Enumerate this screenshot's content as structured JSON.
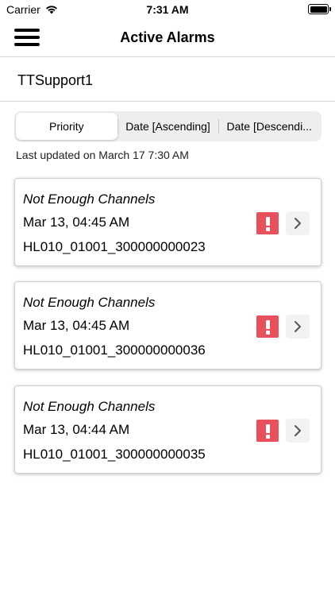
{
  "status_bar": {
    "carrier": "Carrier",
    "time": "7:31 AM"
  },
  "nav": {
    "title": "Active Alarms"
  },
  "account": {
    "name": "TTSupport1"
  },
  "sort": {
    "options": [
      "Priority",
      "Date [Ascending]",
      "Date [Descendi..."
    ],
    "selected": "Priority"
  },
  "last_updated": "Last updated on March 17 7:30 AM",
  "alarms": [
    {
      "type": "Not Enough Channels",
      "date": "Mar 13, 04:45 AM",
      "id": "HL010_01001_300000000023"
    },
    {
      "type": "Not Enough Channels",
      "date": "Mar 13, 04:45 AM",
      "id": "HL010_01001_300000000036"
    },
    {
      "type": "Not Enough Channels",
      "date": "Mar 13, 04:44 AM",
      "id": "HL010_01001_300000000035"
    }
  ],
  "colors": {
    "severity_critical": "#e8505b",
    "divider": "#d6d6d6",
    "segment_bg": "#eeeeef"
  }
}
